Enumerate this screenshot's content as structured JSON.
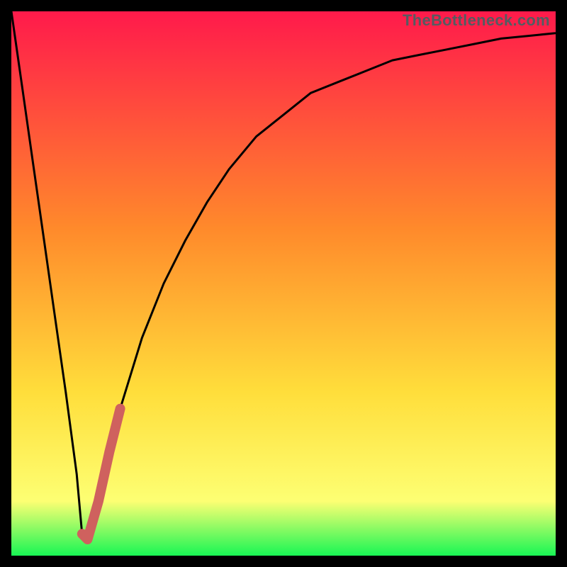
{
  "watermark": "TheBottleneck.com",
  "colors": {
    "gradient_top": "#ff1a4b",
    "gradient_mid1": "#ff8a2b",
    "gradient_mid2": "#ffde3b",
    "gradient_mid3": "#fdff73",
    "gradient_bottom": "#18f654",
    "curve": "#000000",
    "highlight": "#cf615e",
    "background": "#000000"
  },
  "chart_data": {
    "type": "line",
    "title": "",
    "xlabel": "",
    "ylabel": "",
    "xlim": [
      0,
      100
    ],
    "ylim": [
      0,
      100
    ],
    "grid": false,
    "series": [
      {
        "name": "bottleneck-curve",
        "x": [
          0,
          2,
          4,
          6,
          8,
          10,
          12,
          13,
          14,
          16,
          18,
          20,
          24,
          28,
          32,
          36,
          40,
          45,
          50,
          55,
          60,
          65,
          70,
          75,
          80,
          85,
          90,
          95,
          100
        ],
        "y": [
          100,
          86,
          72,
          58,
          44,
          30,
          15,
          4,
          3,
          10,
          19,
          27,
          40,
          50,
          58,
          65,
          71,
          77,
          81,
          85,
          87,
          89,
          91,
          92,
          93,
          94,
          95,
          95.5,
          96
        ]
      },
      {
        "name": "recommended-range-highlight",
        "x": [
          13,
          14,
          16,
          18,
          20
        ],
        "y": [
          4,
          3,
          10,
          19,
          27
        ]
      }
    ]
  }
}
